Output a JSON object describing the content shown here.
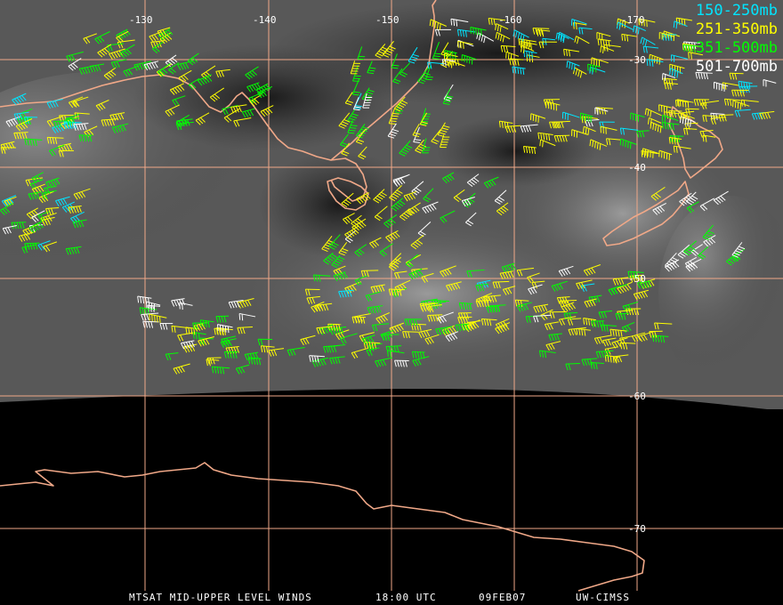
{
  "map": {
    "longitude_labels": [
      "-130",
      "-140",
      "-150",
      "-160",
      "-170"
    ],
    "latitude_labels": [
      "-30",
      "-40",
      "-50",
      "-60",
      "-70"
    ],
    "colors": {
      "grid": "#f0a888",
      "coast": "#f0a888",
      "ice": "#000000",
      "cloud_bg": "#555555"
    }
  },
  "legend": [
    {
      "label": "150-250mb",
      "color": "#00e5ff"
    },
    {
      "label": "251-350mb",
      "color": "#ffff00"
    },
    {
      "label": "351-500mb",
      "color": "#00ff00"
    },
    {
      "label": "501-700mb",
      "color": "#ffffff"
    }
  ],
  "footer": {
    "product": "MTSAT MID-UPPER LEVEL WINDS",
    "time": "18:00 UTC",
    "date": "09FEB07",
    "source": "UW-CIMSS"
  }
}
